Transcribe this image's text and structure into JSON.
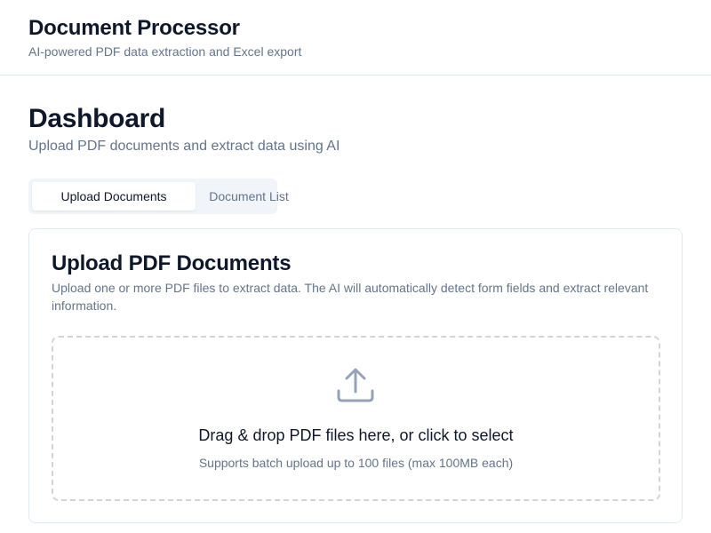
{
  "app": {
    "title": "Document Processor",
    "subtitle": "AI-powered PDF data extraction and Excel export"
  },
  "page": {
    "title": "Dashboard",
    "subtitle": "Upload PDF documents and extract data using AI"
  },
  "tabs": [
    {
      "label": "Upload Documents",
      "active": true
    },
    {
      "label": "Document List",
      "active": false
    }
  ],
  "upload_card": {
    "title": "Upload PDF Documents",
    "description": "Upload one or more PDF files to extract data. The AI will automatically detect form fields and extract relevant information.",
    "dropzone": {
      "icon": "upload-icon",
      "title": "Drag & drop PDF files here, or click to select",
      "hint": "Supports batch upload up to 100 files (max 100MB each)"
    }
  },
  "colors": {
    "text_primary": "#0f172a",
    "text_muted": "#64748b",
    "border": "#e2e8f0",
    "tab_bg": "#f1f5f9",
    "icon": "#94a3b8"
  }
}
